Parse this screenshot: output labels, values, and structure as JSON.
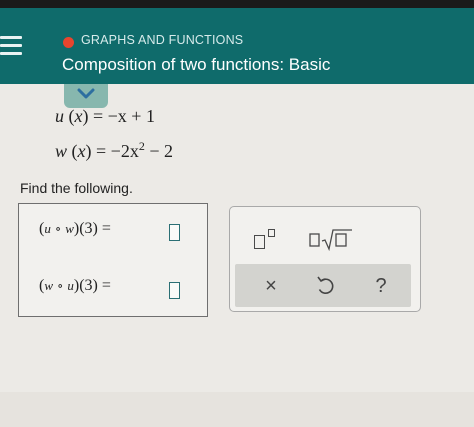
{
  "header": {
    "topic": "GRAPHS AND FUNCTIONS",
    "title": "Composition of two functions: Basic"
  },
  "functions": {
    "u_lhs": "u",
    "u_arg": "x",
    "u_rhs": "= −x + 1",
    "w_lhs": "w",
    "w_arg": "x",
    "w_rhs_1": "= −2x",
    "w_exp": "2",
    "w_rhs_2": " − 2"
  },
  "question": {
    "prompt": "Find the following.",
    "row1": {
      "f": "u",
      "g": "w",
      "input": "(3)",
      "equals": "="
    },
    "row2": {
      "f": "w",
      "g": "u",
      "input": "(3)",
      "equals": "="
    }
  },
  "keypad": {
    "times": "×",
    "help": "?"
  },
  "colors": {
    "header_bg": "#0f6b6b",
    "accent_dot": "#e8452e",
    "collapse_tab": "#87b7ae",
    "input_border": "#2b6f74"
  },
  "icons": [
    "menu-icon",
    "chevron-down-icon",
    "superscript-icon",
    "square-root-icon",
    "undo-icon"
  ]
}
